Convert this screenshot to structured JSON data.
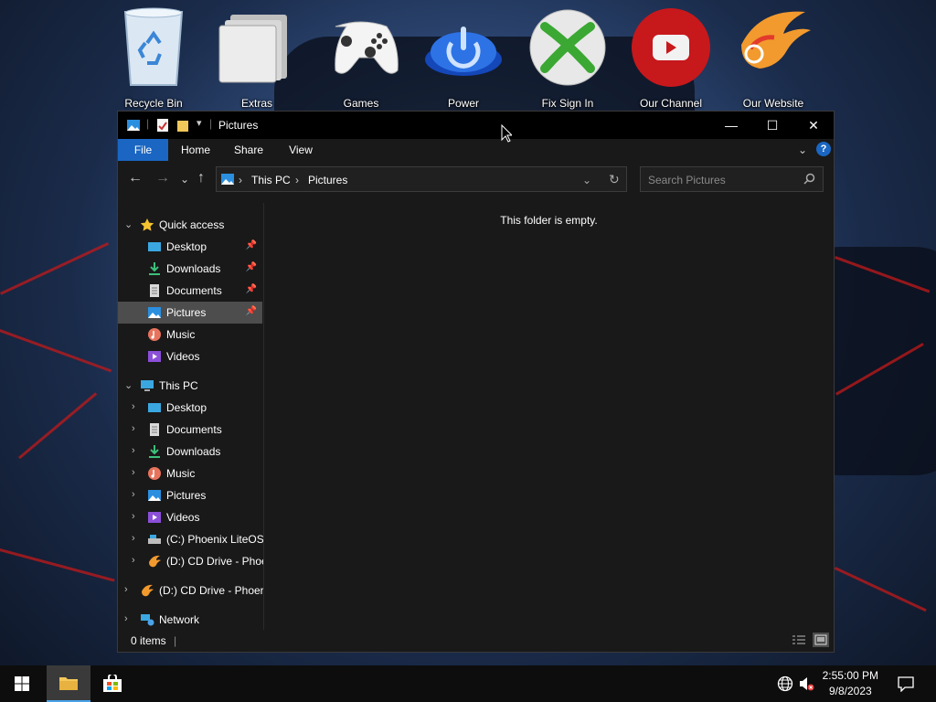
{
  "desktop": {
    "icons": [
      {
        "label": "Recycle Bin",
        "icon": "recycle-bin-icon"
      },
      {
        "label": "Extras",
        "icon": "folder-icon"
      },
      {
        "label": "Games",
        "icon": "gamepad-icon"
      },
      {
        "label": "Power",
        "icon": "power-icon"
      },
      {
        "label": "Fix Sign In",
        "icon": "xbox-icon"
      },
      {
        "label": "Our Channel",
        "icon": "youtube-icon"
      },
      {
        "label": "Our Website",
        "icon": "phoenix-icon"
      }
    ]
  },
  "window": {
    "title": "Pictures",
    "controls": {
      "minimize": "—",
      "maximize": "☐",
      "close": "✕"
    },
    "ribbon_tabs": [
      "File",
      "Home",
      "Share",
      "View"
    ],
    "help": "?",
    "address": {
      "root": "This PC",
      "current": "Pictures"
    },
    "search": {
      "placeholder": "Search Pictures"
    },
    "quick_access": {
      "label": "Quick access",
      "items": [
        {
          "label": "Desktop",
          "pinned": true
        },
        {
          "label": "Downloads",
          "pinned": true
        },
        {
          "label": "Documents",
          "pinned": true
        },
        {
          "label": "Pictures",
          "pinned": true,
          "selected": true
        },
        {
          "label": "Music",
          "pinned": false
        },
        {
          "label": "Videos",
          "pinned": false
        }
      ]
    },
    "this_pc": {
      "label": "This PC",
      "items": [
        "Desktop",
        "Documents",
        "Downloads",
        "Music",
        "Pictures",
        "Videos",
        "(C:) Phoenix LiteOS",
        "(D:) CD Drive - Phoe"
      ]
    },
    "cd_drive": "(D:) CD Drive - Phoer",
    "network": "Network",
    "empty_message": "This folder is empty.",
    "status": "0 items"
  },
  "taskbar": {
    "time": "2:55:00 PM",
    "date": "9/8/2023"
  },
  "colors": {
    "accent": "#1a66c2",
    "window_bg": "#191919",
    "selected": "#4d4d4d"
  }
}
